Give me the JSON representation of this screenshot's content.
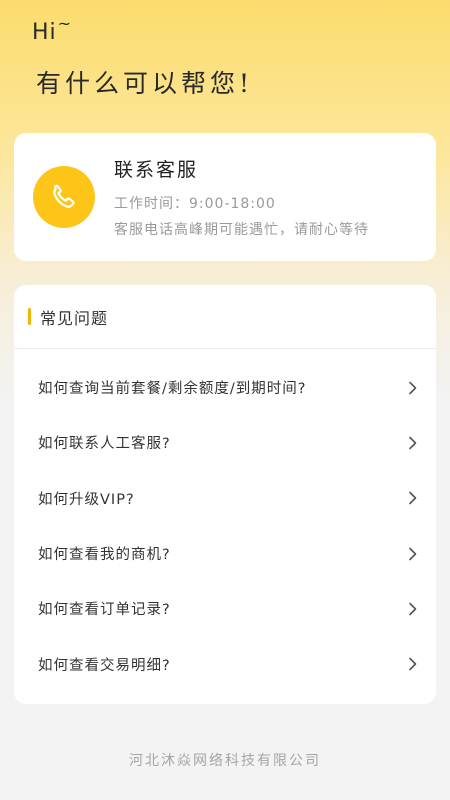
{
  "greeting": {
    "hi": "Hi",
    "tilde": "~",
    "title": "有什么可以帮您!"
  },
  "service": {
    "icon": "phone-icon",
    "title": "联系客服",
    "hours": "工作时间：9:00-18:00",
    "note": "客服电话高峰期可能遇忙，请耐心等待"
  },
  "faq": {
    "title": "常见问题",
    "items": [
      {
        "label": "如何查询当前套餐/剩余额度/到期时间?"
      },
      {
        "label": "如何联系人工客服?"
      },
      {
        "label": "如何升级VIP?"
      },
      {
        "label": "如何查看我的商机?"
      },
      {
        "label": "如何查看订单记录?"
      },
      {
        "label": "如何查看交易明细?"
      }
    ]
  },
  "footer": {
    "company": "河北沐焱网络科技有限公司"
  },
  "colors": {
    "accent": "#fcc517",
    "bar": "#f5b400"
  }
}
